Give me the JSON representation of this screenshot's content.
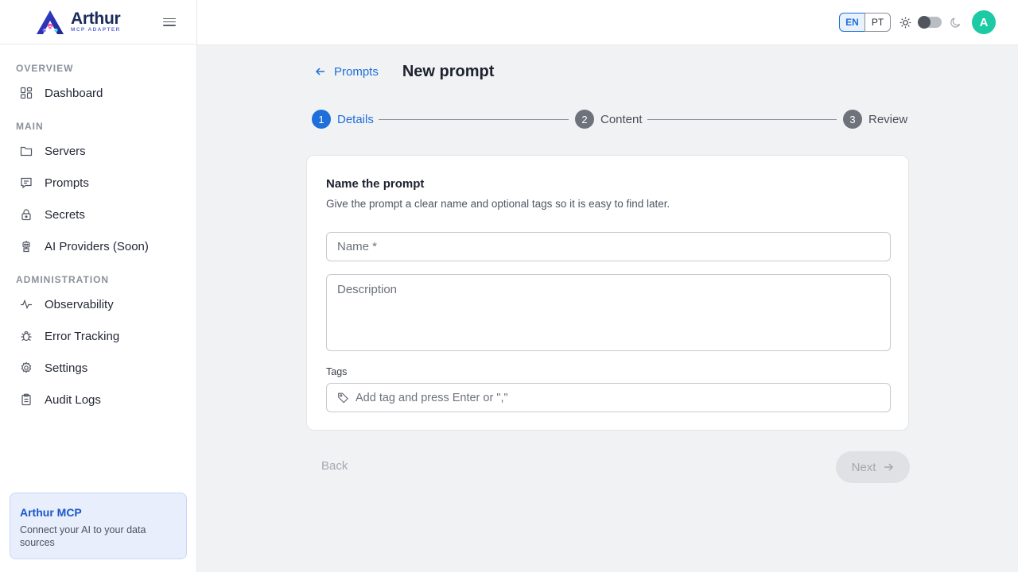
{
  "brand": {
    "name": "Arthur",
    "tagline": "MCP ADAPTER"
  },
  "sidebar": {
    "sections": [
      {
        "title": "OVERVIEW",
        "items": [
          {
            "label": "Dashboard",
            "icon": "dashboard-icon"
          }
        ]
      },
      {
        "title": "MAIN",
        "items": [
          {
            "label": "Servers",
            "icon": "folder-icon"
          },
          {
            "label": "Prompts",
            "icon": "message-square-icon"
          },
          {
            "label": "Secrets",
            "icon": "lock-icon"
          },
          {
            "label": "AI Providers (Soon)",
            "icon": "robot-icon"
          }
        ]
      },
      {
        "title": "ADMINISTRATION",
        "items": [
          {
            "label": "Observability",
            "icon": "activity-icon"
          },
          {
            "label": "Error Tracking",
            "icon": "bug-icon"
          },
          {
            "label": "Settings",
            "icon": "gear-icon"
          },
          {
            "label": "Audit Logs",
            "icon": "clipboard-icon"
          }
        ]
      }
    ],
    "promo": {
      "title": "Arthur MCP",
      "text": "Connect your AI to your data sources"
    }
  },
  "header": {
    "languages": [
      "EN",
      "PT"
    ],
    "active_language": "EN",
    "theme_dark": false,
    "avatar_initial": "A"
  },
  "main": {
    "back_label": "Prompts",
    "title": "New prompt",
    "steps": [
      {
        "number": "1",
        "label": "Details",
        "active": true
      },
      {
        "number": "2",
        "label": "Content",
        "active": false
      },
      {
        "number": "3",
        "label": "Review",
        "active": false
      }
    ],
    "card": {
      "title": "Name the prompt",
      "subtitle": "Give the prompt a clear name and optional tags so it is easy to find later.",
      "name_placeholder": "Name *",
      "description_placeholder": "Description",
      "tags_label": "Tags",
      "tags_placeholder": "Add tag and press Enter or \",\""
    },
    "back_button": "Back",
    "next_button": "Next"
  },
  "colors": {
    "accent": "#1e6fd9",
    "avatar": "#1ccaa3",
    "promo_bg": "#e8eefb"
  }
}
